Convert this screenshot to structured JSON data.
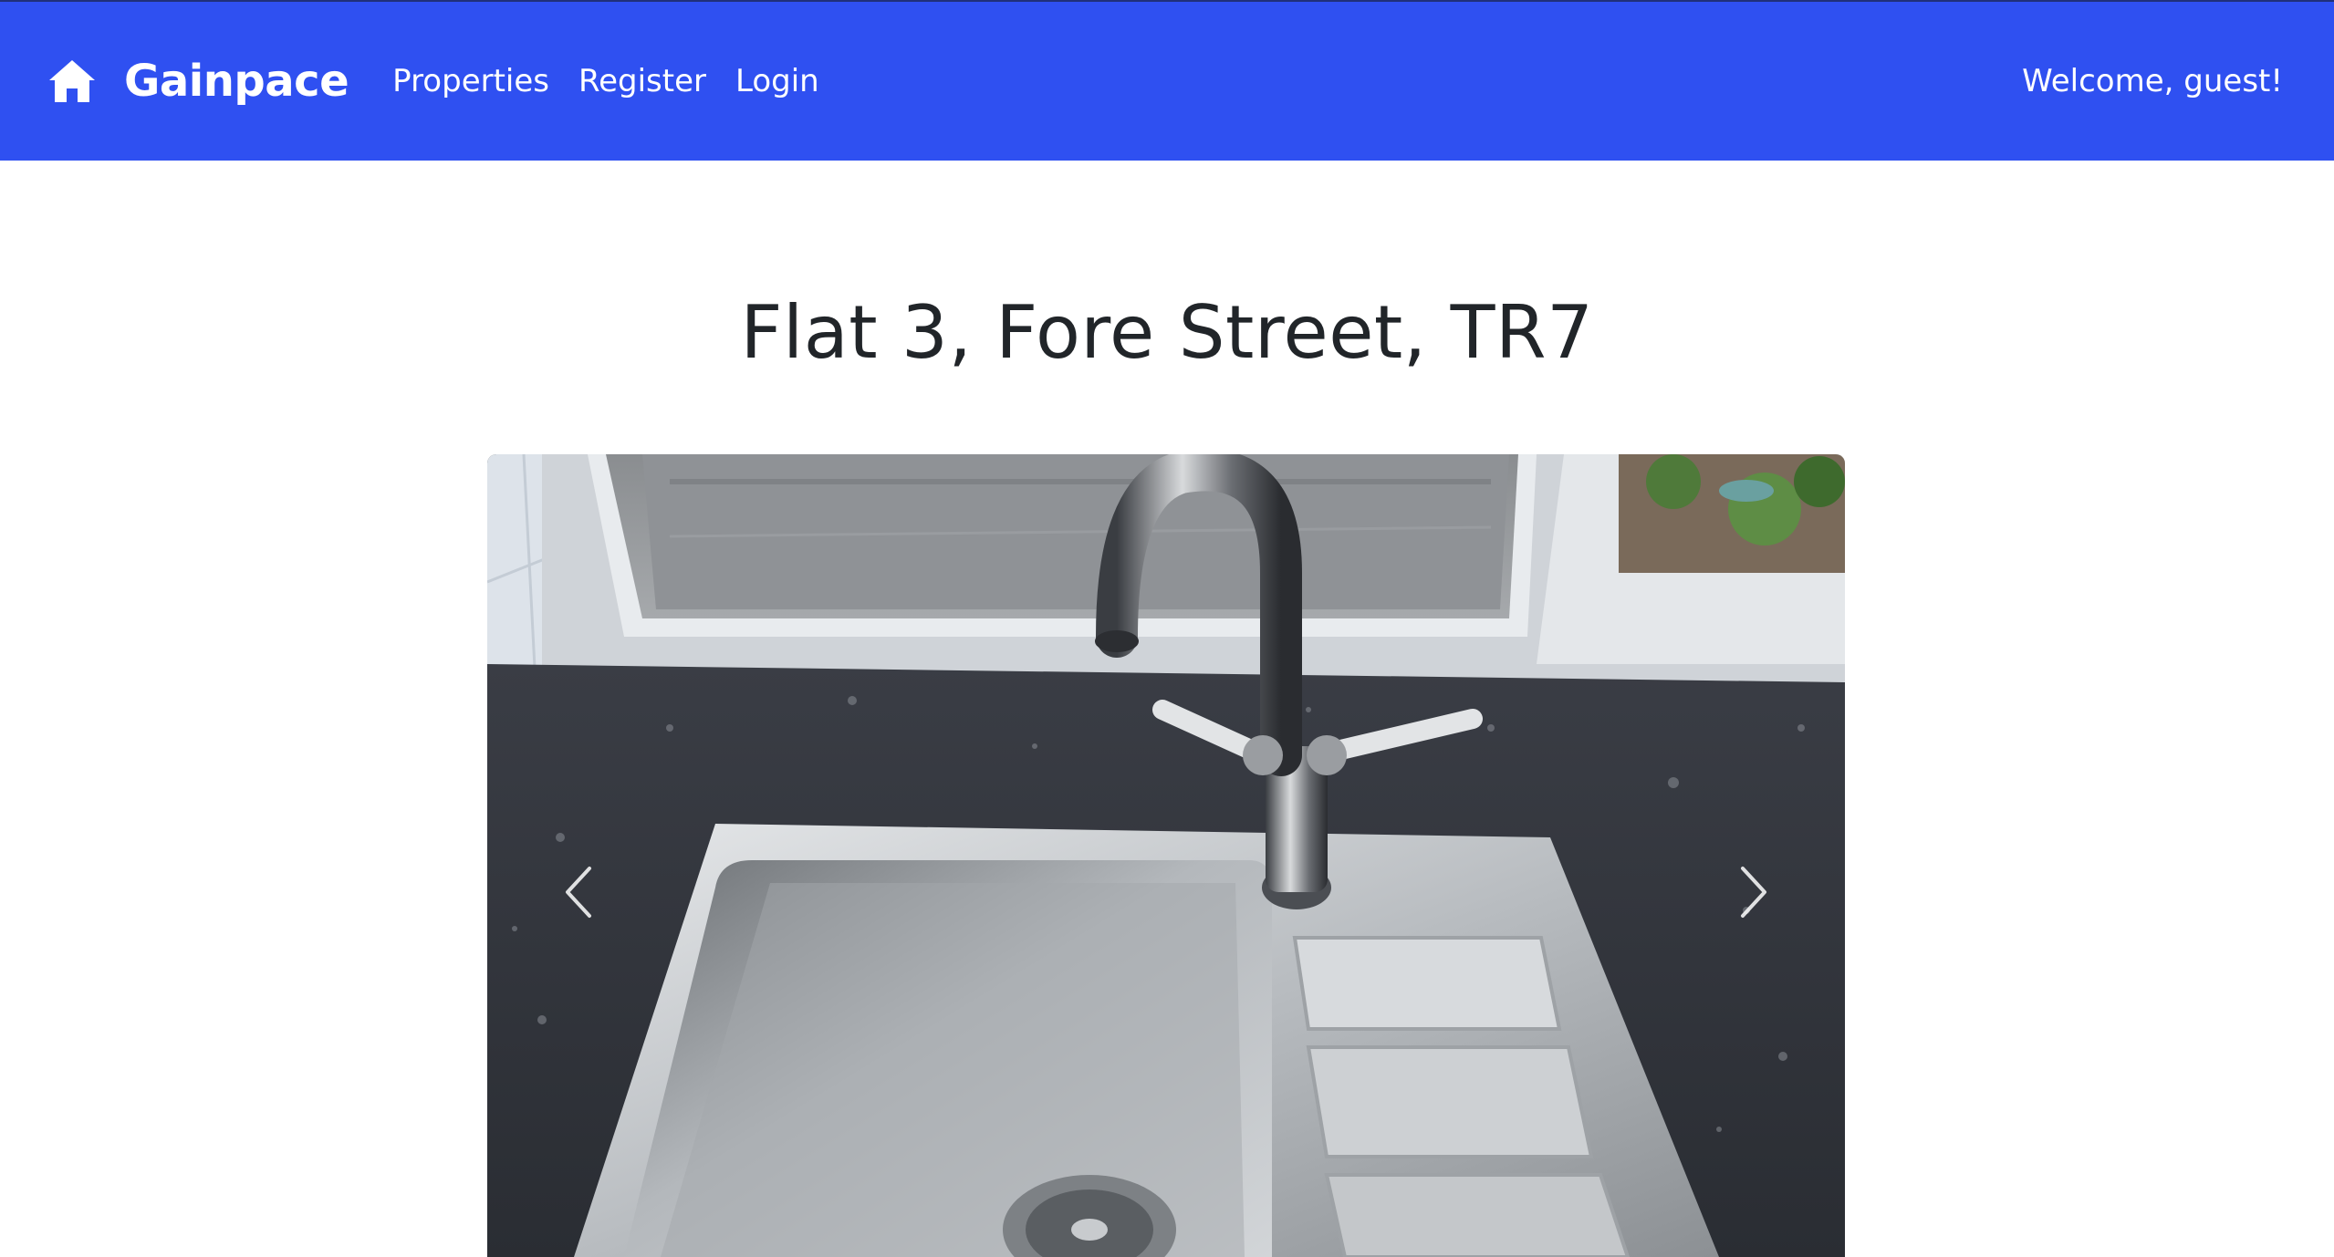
{
  "nav": {
    "brand": "Gainpace",
    "links": [
      "Properties",
      "Register",
      "Login"
    ],
    "welcome": "Welcome, guest!"
  },
  "page": {
    "title": "Flat 3, Fore Street, TR7"
  },
  "carousel": {
    "image_alt": "Stainless steel kitchen sink with mixer tap under window",
    "prev_icon": "chevron-left-icon",
    "next_icon": "chevron-right-icon"
  },
  "colors": {
    "navbar": "#2f50f1",
    "title_text": "#212529",
    "background": "#ffffff"
  }
}
